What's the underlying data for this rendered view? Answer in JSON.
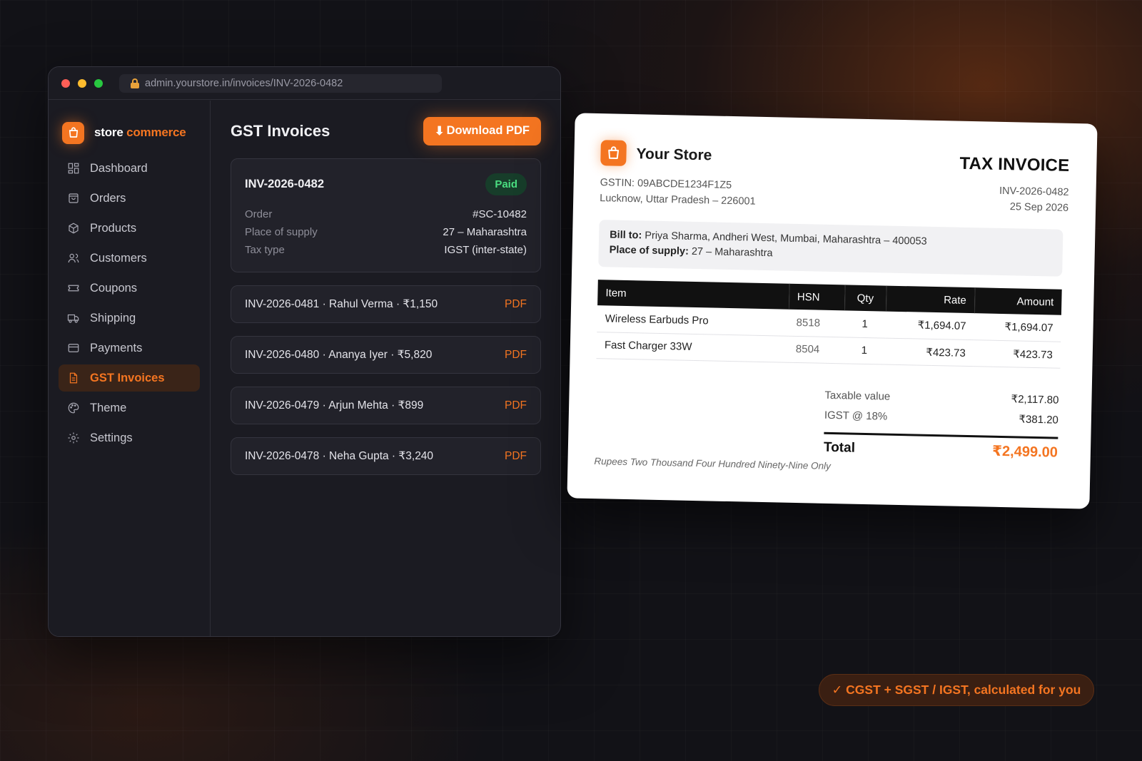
{
  "window": {
    "url": "admin.yourstore.in/invoices/INV-2026-0482"
  },
  "brand": {
    "name_part1": "store",
    "name_part2": "commerce"
  },
  "sidebar": {
    "items": [
      {
        "label": "Dashboard",
        "icon": "dashboard-icon"
      },
      {
        "label": "Orders",
        "icon": "bag-icon"
      },
      {
        "label": "Products",
        "icon": "box-icon"
      },
      {
        "label": "Customers",
        "icon": "users-icon"
      },
      {
        "label": "Coupons",
        "icon": "ticket-icon"
      },
      {
        "label": "Shipping",
        "icon": "truck-icon"
      },
      {
        "label": "Payments",
        "icon": "card-icon"
      },
      {
        "label": "GST Invoices",
        "icon": "document-icon",
        "active": true
      },
      {
        "label": "Theme",
        "icon": "palette-icon"
      },
      {
        "label": "Settings",
        "icon": "gear-icon"
      }
    ]
  },
  "main": {
    "title": "GST Invoices",
    "download_label": "Download PDF",
    "download_arrow": "⬇",
    "featured": {
      "id": "INV-2026-0482",
      "status": "Paid",
      "rows": [
        {
          "k": "Order",
          "v": "#SC-10482"
        },
        {
          "k": "Place of supply",
          "v": "27 – Maharashtra"
        },
        {
          "k": "Tax type",
          "v": "IGST (inter-state)"
        }
      ]
    },
    "invoices": [
      {
        "text": "INV-2026-0481 · Rahul Verma · ₹1,150",
        "action": "PDF"
      },
      {
        "text": "INV-2026-0480 · Ananya Iyer · ₹5,820",
        "action": "PDF"
      },
      {
        "text": "INV-2026-0479 · Arjun Mehta · ₹899",
        "action": "PDF"
      },
      {
        "text": "INV-2026-0478 · Neha Gupta · ₹3,240",
        "action": "PDF"
      }
    ]
  },
  "invoice": {
    "store": "Your Store",
    "gstin": "GSTIN: 09ABCDE1234F1Z5",
    "address": "Lucknow, Uttar Pradesh – 226001",
    "title": "TAX INVOICE",
    "number": "INV-2026-0482",
    "date": "25 Sep 2026",
    "bill_to_label": "Bill to:",
    "bill_to": "Priya Sharma, Andheri West, Mumbai, Maharashtra – 400053",
    "place_label": "Place of supply:",
    "place": "27 – Maharashtra",
    "columns": [
      "Item",
      "HSN",
      "Qty",
      "Rate",
      "Amount"
    ],
    "rows": [
      {
        "item": "Wireless Earbuds Pro",
        "hsn": "8518",
        "qty": "1",
        "rate": "₹1,694.07",
        "amount": "₹1,694.07"
      },
      {
        "item": "Fast Charger 33W",
        "hsn": "8504",
        "qty": "1",
        "rate": "₹423.73",
        "amount": "₹423.73"
      }
    ],
    "taxable_label": "Taxable value",
    "taxable_value": "₹2,117.80",
    "igst_label": "IGST @ 18%",
    "igst_value": "₹381.20",
    "total_label": "Total",
    "total_value": "₹2,499.00",
    "words": "Rupees Two Thousand Four Hundred Ninety-Nine Only"
  },
  "pill": {
    "text": "✓ CGST + SGST / IGST, calculated for you"
  },
  "colors": {
    "accent": "#f47521",
    "paid": "#4ade80",
    "background": "#121217"
  }
}
